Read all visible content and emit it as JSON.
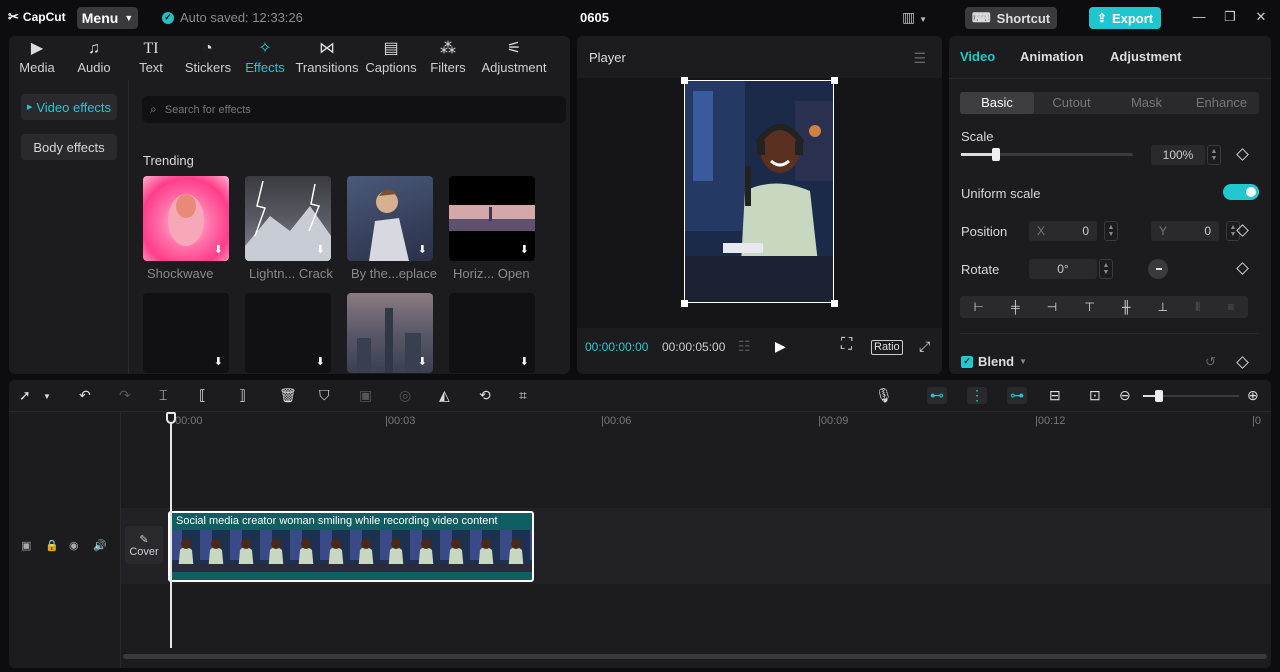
{
  "titlebar": {
    "logo": "CapCut",
    "menu_label": "Menu",
    "autosave": "Auto saved: 12:33:26",
    "project_name": "0605",
    "shortcut_label": "Shortcut",
    "export_label": "Export"
  },
  "media_tabs": [
    "Media",
    "Audio",
    "Text",
    "Stickers",
    "Effects",
    "Transitions",
    "Captions",
    "Filters",
    "Adjustment"
  ],
  "effects": {
    "side_items": [
      "Video effects",
      "Body effects"
    ],
    "search_placeholder": "Search for effects",
    "section": "Trending",
    "cards": [
      "Shockwave",
      "Lightn... Crack",
      "By the...eplace",
      "Horiz... Open"
    ]
  },
  "player": {
    "title": "Player",
    "current_time": "00:00:00:00",
    "duration": "00:00:05:00",
    "ratio_label": "Ratio"
  },
  "properties": {
    "tabs": [
      "Video",
      "Animation",
      "Adjustment"
    ],
    "subtabs": [
      "Basic",
      "Cutout",
      "Mask",
      "Enhance"
    ],
    "scale_label": "Scale",
    "scale_value": "100%",
    "uniform_scale_label": "Uniform scale",
    "position_label": "Position",
    "x_label": "X",
    "x_value": "0",
    "y_label": "Y",
    "y_value": "0",
    "rotate_label": "Rotate",
    "rotate_value": "0°",
    "blend_label": "Blend"
  },
  "timeline": {
    "ticks": [
      "00:00",
      "|00:03",
      "|00:06",
      "|00:09",
      "|00:12",
      "|0"
    ],
    "clip_title": "Social media creator woman smiling while recording video content",
    "cover_label": "Cover"
  },
  "colors": {
    "accent": "#1fc6cf",
    "panel": "#1c1c1f",
    "background": "#0d0d0f"
  }
}
